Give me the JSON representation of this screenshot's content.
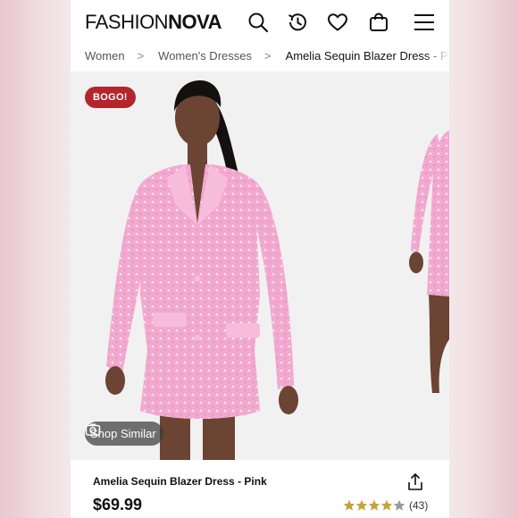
{
  "header": {
    "logo_part1": "FASHION",
    "logo_part2": "NOVA",
    "icons": [
      "search-icon",
      "history-icon",
      "heart-icon",
      "bag-icon",
      "menu-icon"
    ]
  },
  "breadcrumb": {
    "items": [
      "Women",
      "Women's Dresses",
      "Amelia Sequin Blazer Dress - Pink"
    ],
    "separator": ">"
  },
  "gallery": {
    "badge": "BOGO!",
    "shop_similar_label": "Shop Similar"
  },
  "product": {
    "name": "Amelia Sequin Blazer Dress - Pink",
    "price": "$69.99",
    "rating_value": 4,
    "rating_max": 5,
    "review_count": "(43)"
  },
  "colors": {
    "badge": "#b3262c",
    "star": "#c7a23a",
    "dress_pink": "#f2a9cf"
  }
}
